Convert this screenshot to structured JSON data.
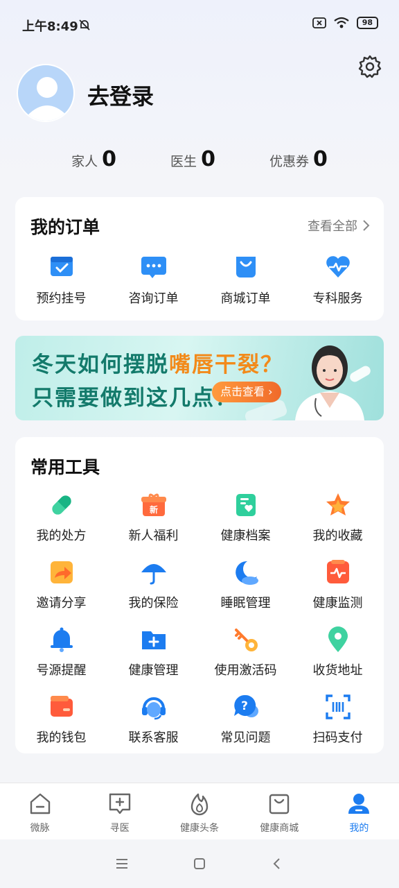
{
  "status_bar": {
    "time": "上午8:49",
    "battery": "98"
  },
  "profile": {
    "login_text": "去登录"
  },
  "stats": [
    {
      "label": "家人",
      "value": "0"
    },
    {
      "label": "医生",
      "value": "0"
    },
    {
      "label": "优惠券",
      "value": "0"
    }
  ],
  "orders": {
    "title": "我的订单",
    "view_all": "查看全部",
    "items": [
      {
        "label": "预约挂号",
        "icon": "calendar-check-icon"
      },
      {
        "label": "咨询订单",
        "icon": "chat-bubble-icon"
      },
      {
        "label": "商城订单",
        "icon": "shopping-bag-icon"
      },
      {
        "label": "专科服务",
        "icon": "heart-pulse-icon"
      }
    ]
  },
  "banner": {
    "line1_part1": "冬天如何摆脱",
    "line1_highlight": "嘴唇干裂？",
    "line2": "只需要做到这几点！",
    "button": "点击查看"
  },
  "tools": {
    "title": "常用工具",
    "items": [
      {
        "label": "我的处方",
        "icon": "pill-icon"
      },
      {
        "label": "新人福利",
        "icon": "gift-icon",
        "badge": "新"
      },
      {
        "label": "健康档案",
        "icon": "health-record-icon"
      },
      {
        "label": "我的收藏",
        "icon": "star-icon"
      },
      {
        "label": "邀请分享",
        "icon": "share-icon"
      },
      {
        "label": "我的保险",
        "icon": "umbrella-icon"
      },
      {
        "label": "睡眠管理",
        "icon": "moon-icon"
      },
      {
        "label": "健康监测",
        "icon": "monitor-icon"
      },
      {
        "label": "号源提醒",
        "icon": "bell-icon"
      },
      {
        "label": "健康管理",
        "icon": "folder-plus-icon"
      },
      {
        "label": "使用激活码",
        "icon": "key-icon"
      },
      {
        "label": "收货地址",
        "icon": "location-pin-icon"
      },
      {
        "label": "我的钱包",
        "icon": "wallet-icon"
      },
      {
        "label": "联系客服",
        "icon": "headset-icon"
      },
      {
        "label": "常见问题",
        "icon": "question-icon"
      },
      {
        "label": "扫码支付",
        "icon": "scan-icon"
      }
    ]
  },
  "tab_bar": {
    "active": "我的",
    "tabs": [
      {
        "label": "微脉",
        "icon": "home-icon"
      },
      {
        "label": "寻医",
        "icon": "find-doctor-icon"
      },
      {
        "label": "健康头条",
        "icon": "flame-icon"
      },
      {
        "label": "健康商城",
        "icon": "mall-bag-icon"
      },
      {
        "label": "我的",
        "icon": "profile-icon"
      }
    ]
  },
  "colors": {
    "accent": "#1c7cf0",
    "banner_text": "#137a6b",
    "banner_highlight": "#f28a1a"
  }
}
